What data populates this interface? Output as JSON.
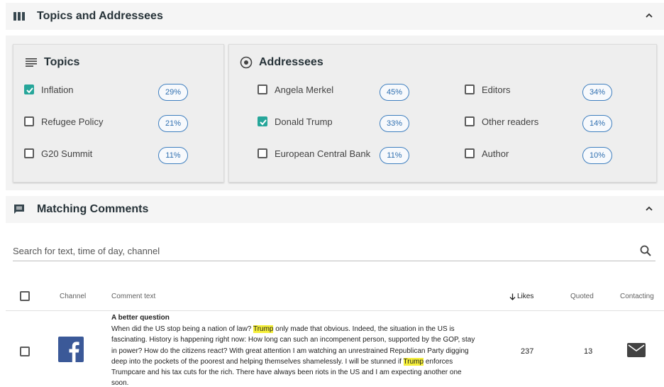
{
  "topics_section": {
    "title": "Topics and Addressees"
  },
  "topics": {
    "title": "Topics",
    "items": [
      {
        "label": "Inflation",
        "checked": true,
        "percent": "29%"
      },
      {
        "label": "Refugee Policy",
        "checked": false,
        "percent": "21%"
      },
      {
        "label": "G20 Summit",
        "checked": false,
        "percent": "11%"
      }
    ]
  },
  "addressees": {
    "title": "Addressees",
    "items": [
      {
        "label": "Angela Merkel",
        "checked": false,
        "percent": "45%"
      },
      {
        "label": "Donald Trump",
        "checked": true,
        "percent": "33%"
      },
      {
        "label": "European Central Bank",
        "checked": false,
        "percent": "11%"
      },
      {
        "label": "Editors",
        "checked": false,
        "percent": "34%"
      },
      {
        "label": "Other readers",
        "checked": false,
        "percent": "14%"
      },
      {
        "label": "Author",
        "checked": false,
        "percent": "10%"
      }
    ]
  },
  "comments_section": {
    "title": "Matching Comments",
    "search_placeholder": "Search for text, time of day, channel"
  },
  "table": {
    "columns": {
      "channel": "Channel",
      "comment_text": "Comment text",
      "likes": "Likes",
      "quoted": "Quoted",
      "contacting": "Contacting"
    },
    "rows": [
      {
        "channel": "facebook",
        "title": "A better question",
        "text_parts": [
          "When did the US stop being a nation of law? ",
          "Trump",
          " only made that obvious. Indeed, the situation in the US is fascinating. History is happening right now: How long can such an incompenent person, supported by the GOP, stay in power? How do the citizens react? With great attention I am watching an unrestrained Republican Party digging deep into the pockets of the poorest and helping themselves shamelessly. I will be stunned if ",
          "Trump",
          " enforces Trumpcare and his tax cuts for the rich. There have always been riots in the US and I am expecting another one soon."
        ],
        "likes": "237",
        "quoted": "13"
      }
    ]
  },
  "colors": {
    "checkbox_checked": "#26a69a",
    "pill_border": "#3f7fbf",
    "highlight": "#f5ef3a",
    "facebook_blue": "#3b5998"
  },
  "icons": {
    "topics_section": "columns-icon",
    "topics_card": "lines-icon",
    "addressees_card": "radio-target-icon",
    "comments_section": "comment-icon",
    "search": "search-icon",
    "collapse": "chevron-up-icon",
    "sort": "arrow-down-icon",
    "contact": "mail-icon"
  }
}
